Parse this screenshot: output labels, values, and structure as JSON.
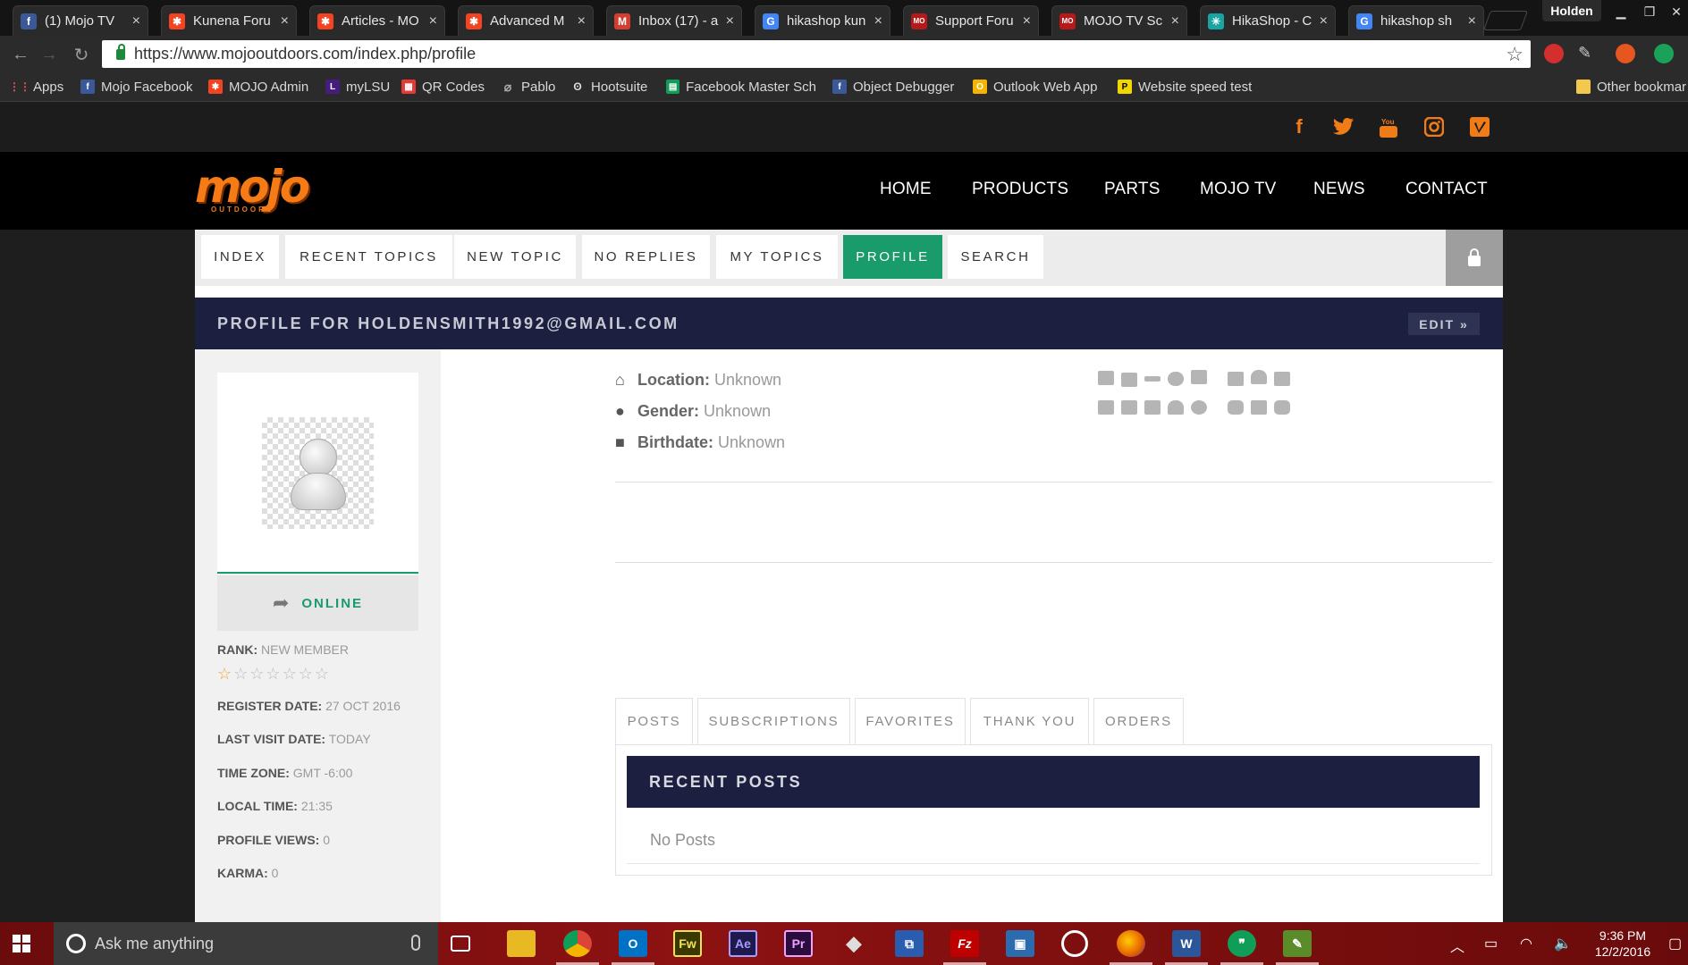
{
  "browser": {
    "tabs": [
      {
        "title": "(1) Mojo TV",
        "icon": "facebook-icon",
        "color": "#3b5998",
        "glyph": "f"
      },
      {
        "title": "Kunena Foru",
        "icon": "joomla-icon",
        "color": "#f44321",
        "glyph": "✱"
      },
      {
        "title": "Articles - MO",
        "icon": "joomla-icon",
        "color": "#f44321",
        "glyph": "✱"
      },
      {
        "title": "Advanced M",
        "icon": "joomla-icon",
        "color": "#f44321",
        "glyph": "✱"
      },
      {
        "title": "Inbox (17) - a",
        "icon": "gmail-icon",
        "color": "#d23f31",
        "glyph": "M"
      },
      {
        "title": "hikashop kun",
        "icon": "google-icon",
        "color": "#4285f4",
        "glyph": "G"
      },
      {
        "title": "Support Foru",
        "icon": "mojo-icon",
        "color": "#b51a1a",
        "glyph": "MO"
      },
      {
        "title": "MOJO TV Sc",
        "icon": "mojo-icon",
        "color": "#b51a1a",
        "glyph": "MO"
      },
      {
        "title": "HikaShop - C",
        "icon": "hikashop-icon",
        "color": "#1aa3a3",
        "glyph": "✳"
      },
      {
        "title": "hikashop sh",
        "icon": "google-icon",
        "color": "#4285f4",
        "glyph": "G"
      }
    ],
    "close_glyph": "×",
    "profile_name": "Holden",
    "url": "https://www.mojooutdoors.com/index.php/profile",
    "bookmarks": [
      {
        "label": "Apps",
        "icon": "apps-icon",
        "color": "#d44",
        "glyph": "⋮⋮"
      },
      {
        "label": "Mojo Facebook",
        "icon": "facebook-icon",
        "color": "#3b5998",
        "glyph": "f"
      },
      {
        "label": "MOJO Admin",
        "icon": "joomla-icon",
        "color": "#f44321",
        "glyph": "✱"
      },
      {
        "label": "myLSU",
        "icon": "lsu-icon",
        "color": "#461d7c",
        "glyph": "L"
      },
      {
        "label": "QR Codes",
        "icon": "qr-icon",
        "color": "#e53935",
        "glyph": "▦"
      },
      {
        "label": "Pablo",
        "icon": "pablo-icon",
        "color": "#555",
        "glyph": "⌀"
      },
      {
        "label": "Hootsuite",
        "icon": "hootsuite-icon",
        "color": "#333",
        "glyph": "ʘ"
      },
      {
        "label": "Facebook Master Sch",
        "icon": "sheets-icon",
        "color": "#0f9d58",
        "glyph": "▤"
      },
      {
        "label": "Object Debugger",
        "icon": "facebook-icon",
        "color": "#3b5998",
        "glyph": "f"
      },
      {
        "label": "Outlook Web App",
        "icon": "outlook-icon",
        "color": "#f4b400",
        "glyph": "O"
      },
      {
        "label": "Website speed test",
        "icon": "pingdom-icon",
        "color": "#f2d600",
        "glyph": "P"
      },
      {
        "label": "Other bookmar",
        "icon": "folder-icon",
        "color": "#f2c94c",
        "glyph": ""
      }
    ]
  },
  "site": {
    "social": [
      {
        "name": "facebook-icon",
        "glyph": "f"
      },
      {
        "name": "twitter-icon",
        "glyph": "🐦"
      },
      {
        "name": "youtube-icon",
        "glyph": "▶"
      },
      {
        "name": "instagram-icon",
        "glyph": "◎"
      },
      {
        "name": "vimeo-icon",
        "glyph": "v"
      }
    ],
    "logo_text": "mojo",
    "logo_sub": "OUTDOORS",
    "nav": [
      "HOME",
      "PRODUCTS",
      "PARTS",
      "MOJO TV",
      "NEWS",
      "CONTACT"
    ],
    "accent": "#f47b16"
  },
  "forum": {
    "menu": [
      "INDEX",
      "RECENT TOPICS",
      "NEW TOPIC",
      "NO REPLIES",
      "MY TOPICS",
      "PROFILE",
      "SEARCH"
    ],
    "active_menu": "PROFILE",
    "profile_title": "PROFILE FOR HOLDENSMITH1992@GMAIL.COM",
    "edit_label": "EDIT »",
    "status": "ONLINE",
    "rank_label": "RANK:",
    "rank_value": "NEW MEMBER",
    "stars_filled": 1,
    "stars_total": 7,
    "register_label": "REGISTER DATE:",
    "register_value": "27 OCT 2016",
    "last_visit_label": "LAST VISIT DATE:",
    "last_visit_value": "TODAY",
    "timezone_label": "TIME ZONE:",
    "timezone_value": "GMT -6:00",
    "localtime_label": "LOCAL TIME:",
    "localtime_value": "21:35",
    "views_label": "PROFILE VIEWS:",
    "views_value": "0",
    "karma_label": "KARMA:",
    "karma_value": "0",
    "location_label": "Location:",
    "location_value": "Unknown",
    "gender_label": "Gender:",
    "gender_value": "Unknown",
    "birthdate_label": "Birthdate:",
    "birthdate_value": "Unknown",
    "tabs": [
      "POSTS",
      "SUBSCRIPTIONS",
      "FAVORITES",
      "THANK YOU",
      "ORDERS"
    ],
    "recent_title": "RECENT POSTS",
    "no_posts": "No Posts",
    "green": "#1a9b6c",
    "navy": "#1c1f3f"
  },
  "taskbar": {
    "search_placeholder": "Ask me anything",
    "time": "9:36 PM",
    "date": "12/2/2016",
    "apps": [
      {
        "name": "task-view-icon",
        "glyph": "▭",
        "color": "transparent"
      },
      {
        "name": "file-explorer-icon",
        "glyph": "📁",
        "color": "#e8b923"
      },
      {
        "name": "chrome-icon",
        "glyph": "◉",
        "color": "#db4437"
      },
      {
        "name": "outlook-icon",
        "glyph": "O",
        "color": "#0072c6"
      },
      {
        "name": "fireworks-icon",
        "glyph": "Fw",
        "color": "#3a3a00"
      },
      {
        "name": "after-effects-icon",
        "glyph": "Ae",
        "color": "#1f1a4d"
      },
      {
        "name": "premiere-icon",
        "glyph": "Pr",
        "color": "#2a0c3d"
      },
      {
        "name": "app-icon",
        "glyph": "◆",
        "color": "#444"
      },
      {
        "name": "network-icon",
        "glyph": "⧉",
        "color": "#2a5db0"
      },
      {
        "name": "filezilla-icon",
        "glyph": "Fz",
        "color": "#bf0000"
      },
      {
        "name": "remote-icon",
        "glyph": "▣",
        "color": "#2b6cb0"
      },
      {
        "name": "itunes-icon",
        "glyph": "◎",
        "color": "#222"
      },
      {
        "name": "firefox-icon",
        "glyph": "●",
        "color": "#e66000"
      },
      {
        "name": "word-icon",
        "glyph": "W",
        "color": "#2b579a"
      },
      {
        "name": "hangouts-icon",
        "glyph": "❞",
        "color": "#0f9d58"
      },
      {
        "name": "notepad-icon",
        "glyph": "✎",
        "color": "#5b8c2a"
      }
    ]
  }
}
